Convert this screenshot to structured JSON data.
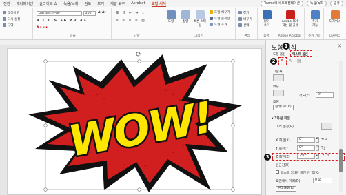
{
  "menubar": {
    "tabs": [
      "전환",
      "애니메이션",
      "슬라이드 쇼",
      "녹음/녹화",
      "검토",
      "보기",
      "개발 도구",
      "Acrobat",
      "도형 서식"
    ],
    "active_tab": "도형 서식",
    "teams_label": "Teams에서 프레젠테이션",
    "record_label": "녹음/녹화",
    "share_label": "공유"
  },
  "ribbon": {
    "slides": {
      "layout": "레이아웃",
      "reset": "다시 설정",
      "section": "구역",
      "label": ""
    },
    "font": {
      "name": "ON)  모바일POP",
      "size": "200",
      "label": "글꼴"
    },
    "paragraph": {
      "label": "단락"
    },
    "drawing": {
      "label": "그리기",
      "shapes": "도형",
      "arrange": "정렬",
      "quick_styles": "빠른\n스타일",
      "fill": "도형 채우기",
      "outline": "도형 윤곽선",
      "effects": "도형 효과"
    },
    "editing": {
      "find": "찾기",
      "replace": "바꾸기",
      "select": "선택",
      "label": "편집"
    },
    "voice": {
      "dictate": "받아\n쓰기",
      "label": "음성"
    },
    "adobe": {
      "create_pdf": "Adobe PDF\n작성 및 공유",
      "label": "Adobe Acrobat"
    },
    "addins": {
      "addins": "추가\n기능",
      "label": "추가 기능"
    },
    "designer": {
      "designer": "디자이너",
      "label": "디자이너"
    }
  },
  "pane": {
    "title": "도형 서식",
    "tab_shape": "도형 옵션",
    "tab_text": "텍스트 옵션",
    "shadow_label": "그림자",
    "reflection_label": "반사",
    "glow_label": "조명",
    "softedge_label": "각도(E)",
    "softedge_value": "0°",
    "reset_1": "원래대로(R)",
    "rotation3d_label": "3차원 회전",
    "presets_label": "미리 설정(P)",
    "x_label": "X 회전(X)",
    "x_value": "0°",
    "y_label": "Y 회전(Y)",
    "y_value": "0°",
    "z_label": "Z 회전(Z)",
    "z_value": "350°",
    "perspective_label": "원근감(E)",
    "keep_text_flat": "텍스트 3차원 회전 안 함(K)",
    "distance_label": "표면에서 거리(D)",
    "distance_value": "0 pt",
    "reset_2": "원래대로(R)"
  },
  "badges": [
    "1",
    "2",
    "3"
  ],
  "art": {
    "text": "WOW!",
    "colors": {
      "outer": "#111111",
      "burst": "#d11f1f",
      "letters": "#ffe600",
      "stroke": "#111111"
    }
  },
  "colors": {
    "accent": "#c43e1c",
    "highlight": "#d81b1b"
  }
}
